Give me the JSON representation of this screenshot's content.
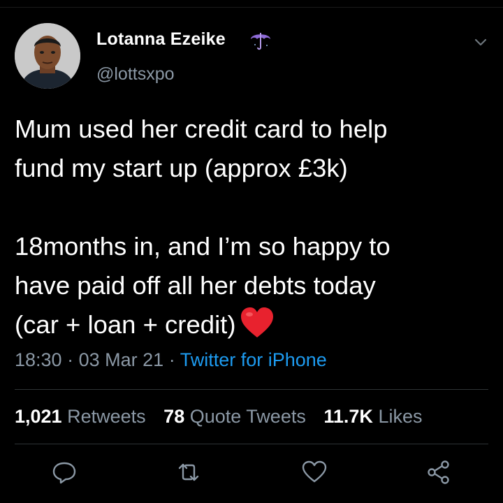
{
  "user": {
    "display_name": "Lotanna Ezeike",
    "handle": "@lottsxpo",
    "badge_icon": "umbrella-icon"
  },
  "tweet": {
    "paragraph1_line1": "Mum used her credit card to help",
    "paragraph1_line2": "fund my start up (approx £3k)",
    "paragraph2_line1": "18months in, and I’m so happy to",
    "paragraph2_line2": "have paid off all her debts today",
    "paragraph2_line3": "(car + loan + credit)",
    "emoji": "red-heart"
  },
  "meta": {
    "time": "18:30",
    "date": "03 Mar 21",
    "separator": "·",
    "source": "Twitter for iPhone"
  },
  "stats": {
    "retweets_count": "1,021",
    "retweets_label": "Retweets",
    "quotes_count": "78",
    "quotes_label": "Quote Tweets",
    "likes_count": "11.7K",
    "likes_label": "Likes"
  },
  "colors": {
    "background": "#000000",
    "text": "#ffffff",
    "secondary": "#8b98a5",
    "link": "#1d9bf0",
    "heart": "#e8222e"
  },
  "icons": [
    "chevron-down-icon",
    "reply-icon",
    "retweet-icon",
    "like-icon",
    "share-icon"
  ]
}
